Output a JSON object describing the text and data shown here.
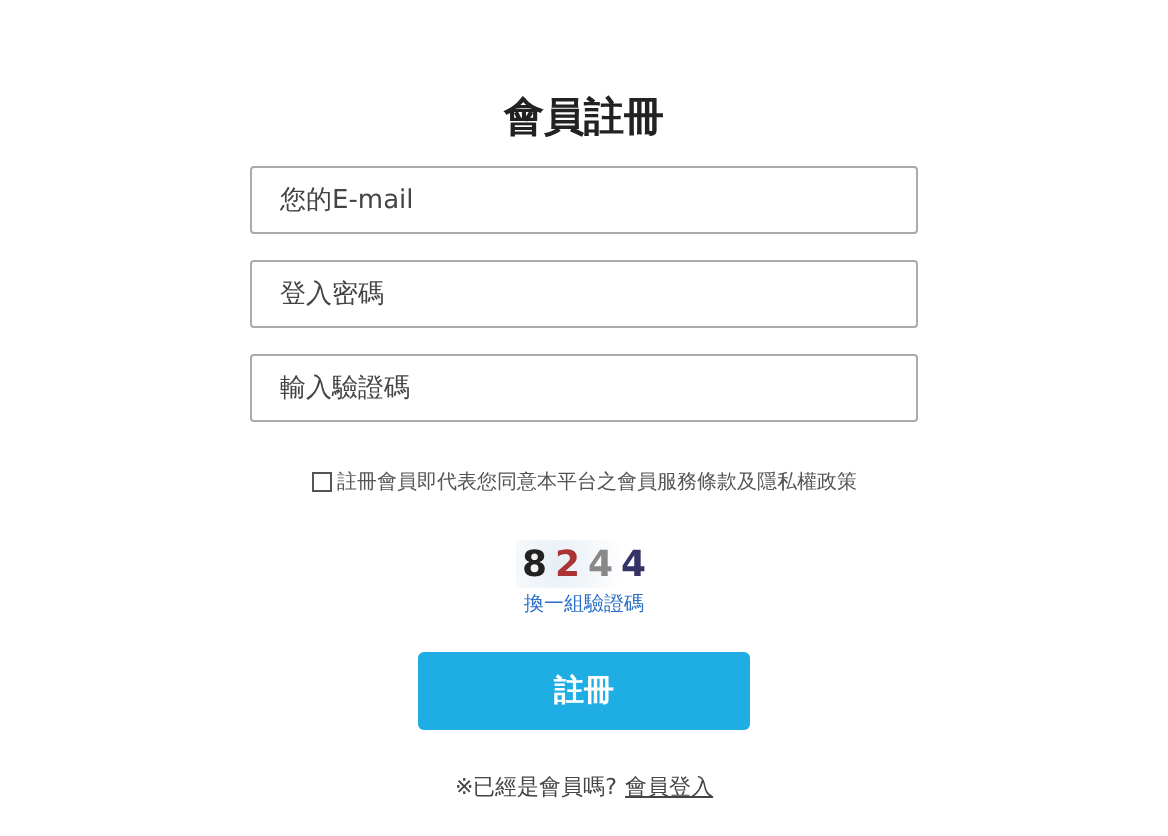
{
  "title": "會員註冊",
  "fields": [
    {
      "placeholder": "您的E-mail"
    },
    {
      "placeholder": "登入密碼"
    },
    {
      "placeholder": "輸入驗證碼"
    }
  ],
  "agreement": {
    "checked": false,
    "label": "註冊會員即代表您同意本平台之會員服務條款及隱私權政策"
  },
  "captcha": {
    "code": "8244",
    "refresh_link": "換一組驗證碼"
  },
  "submit_button": "註冊",
  "footer": {
    "text": "※已經是會員嗎?",
    "link": "會員登入"
  }
}
